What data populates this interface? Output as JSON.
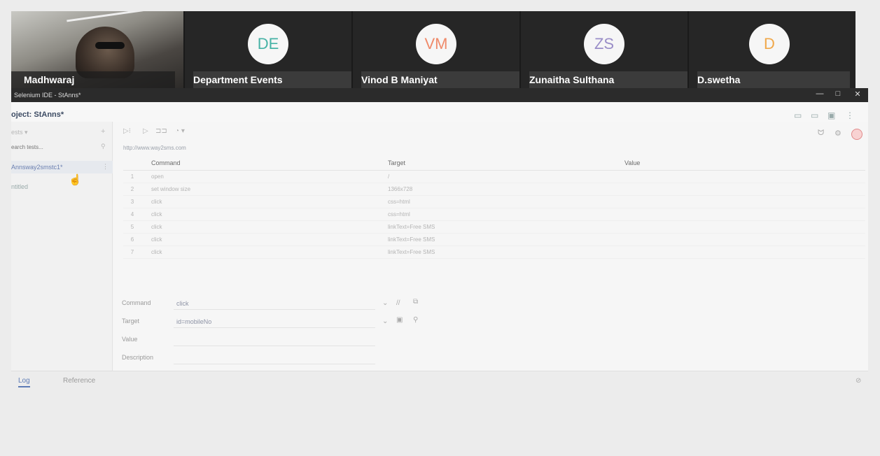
{
  "meeting": {
    "participants": [
      {
        "name": "Madhwaraj",
        "initials": "",
        "color": ""
      },
      {
        "name": "Department Events",
        "initials": "DE",
        "color": "#47b3a6"
      },
      {
        "name": "Vinod B Maniyat",
        "initials": "VM",
        "color": "#ef8a6a"
      },
      {
        "name": "Zunaitha Sulthana",
        "initials": "ZS",
        "color": "#9a8ec8"
      },
      {
        "name": "D.swetha",
        "initials": "D",
        "color": "#f0a84a"
      }
    ]
  },
  "window": {
    "title": "Selenium IDE - StAnns*",
    "controls": {
      "minimize": "—",
      "maximize": "□",
      "close": "✕"
    }
  },
  "project": {
    "label": "oject: StAnns*"
  },
  "sidebar": {
    "suite_select": "ests ▾",
    "add": "+",
    "search_placeholder": "earch tests...",
    "tests": [
      "Annsway2smstc1*",
      "ntitled"
    ],
    "test_menu": "⋮"
  },
  "toolbar": {
    "run_all": "▷⁝",
    "run": "▷",
    "step": "⊐⊐",
    "speed": "◔ ▾"
  },
  "right_tools": {
    "disable_bp": "ᗢ",
    "settings": "⚙"
  },
  "url": "http://www.way2sms.com",
  "table": {
    "headers": {
      "command": "Command",
      "target": "Target",
      "value": "Value"
    },
    "rows": [
      {
        "num": "1",
        "command": "open",
        "target": "/",
        "value": ""
      },
      {
        "num": "2",
        "command": "set window size",
        "target": "1366x728",
        "value": ""
      },
      {
        "num": "3",
        "command": "click",
        "target": "css=html",
        "value": ""
      },
      {
        "num": "4",
        "command": "click",
        "target": "css=html",
        "value": ""
      },
      {
        "num": "5",
        "command": "click",
        "target": "linkText=Free SMS",
        "value": ""
      },
      {
        "num": "6",
        "command": "click",
        "target": "linkText=Free SMS",
        "value": ""
      },
      {
        "num": "7",
        "command": "click",
        "target": "linkText=Free SMS",
        "value": ""
      }
    ]
  },
  "editor": {
    "command_label": "Command",
    "command_value": "click",
    "target_label": "Target",
    "target_value": "id=mobileNo",
    "value_label": "Value",
    "value_value": "",
    "description_label": "Description",
    "description_value": ""
  },
  "bottom": {
    "tab_log": "Log",
    "tab_reference": "Reference",
    "clear": "⊘"
  }
}
